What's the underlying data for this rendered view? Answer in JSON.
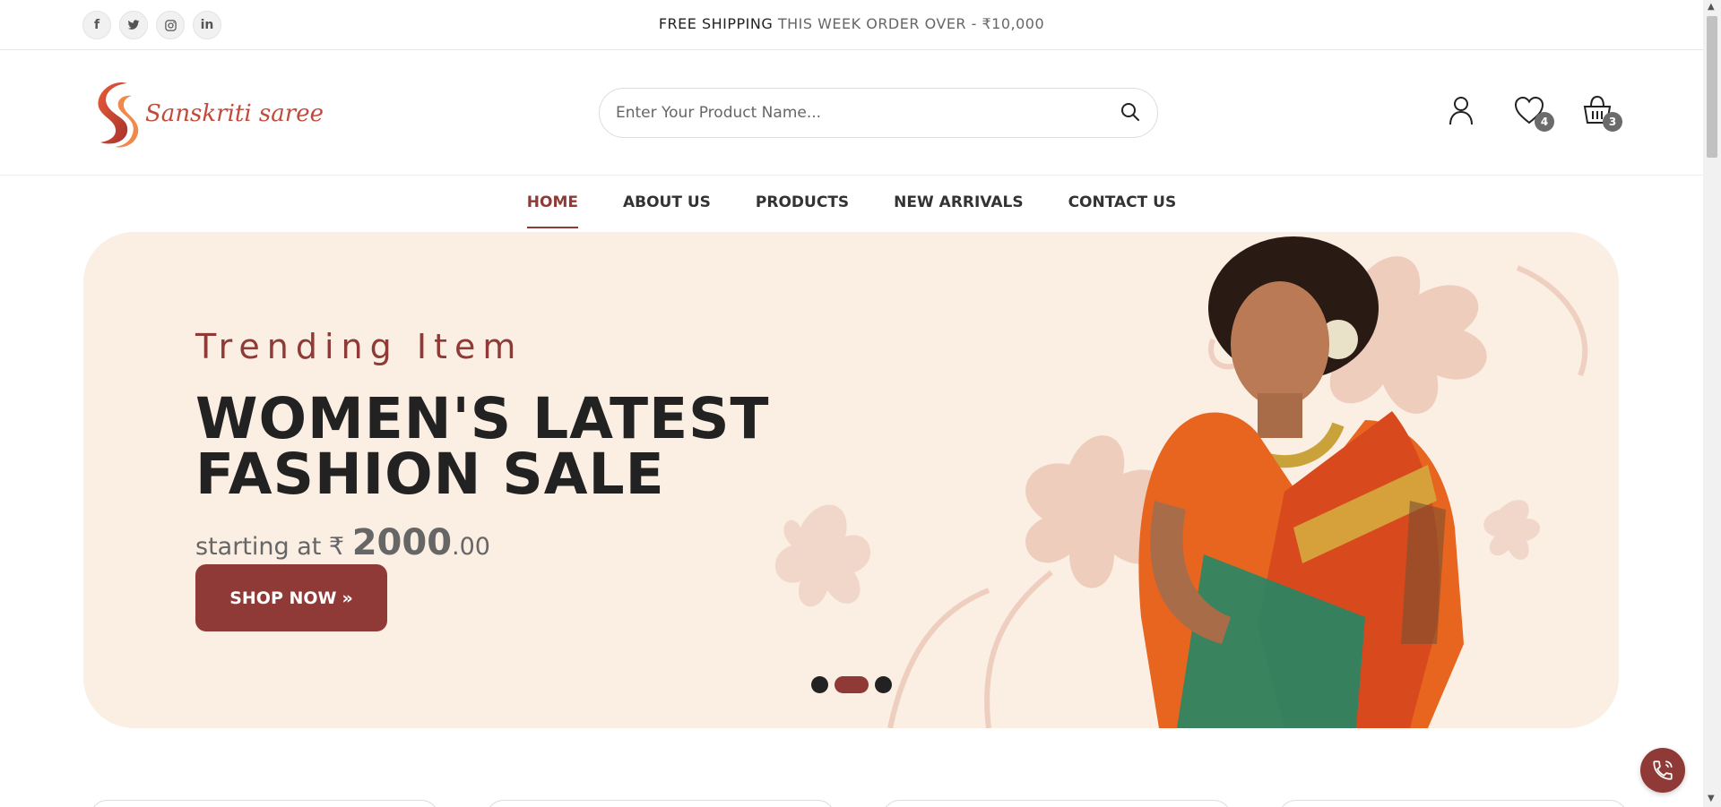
{
  "topbar": {
    "social": [
      {
        "icon": "facebook-icon",
        "glyph": "f"
      },
      {
        "icon": "twitter-icon",
        "glyph": "t"
      },
      {
        "icon": "instagram-icon",
        "glyph": "◎"
      },
      {
        "icon": "linkedin-icon",
        "glyph": "in"
      }
    ],
    "shipping_bold": "FREE SHIPPING",
    "shipping_rest": " THIS WEEK ORDER OVER - ₹10,000"
  },
  "header": {
    "logo_text": "Sanskriti saree",
    "search_placeholder": "Enter Your Product Name...",
    "wishlist_count": "4",
    "cart_count": "3"
  },
  "nav": {
    "items": [
      "HOME",
      "ABOUT US",
      "PRODUCTS",
      "NEW ARRIVALS",
      "CONTACT US"
    ],
    "active": "HOME"
  },
  "hero": {
    "subtitle": "Trending Item",
    "title_line1": "WOMEN'S LATEST",
    "title_line2": "FASHION SALE",
    "price_prefix": "starting at ₹ ",
    "price_major": "2000",
    "price_minor": ".00",
    "button_label": "SHOP NOW",
    "button_icon": "»",
    "slides": 3,
    "active_slide": 2
  },
  "colors": {
    "accent": "#8f3a36",
    "hero_bg": "#fbeee3"
  }
}
